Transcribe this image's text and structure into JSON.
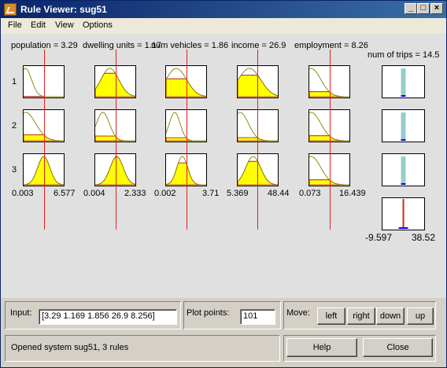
{
  "window": {
    "title": "Rule Viewer: sug51",
    "controls": {
      "minimize": "_",
      "maximize": "□",
      "close": "×"
    }
  },
  "menu": [
    "File",
    "Edit",
    "View",
    "Options"
  ],
  "inputs": [
    {
      "label": "population = 3.29",
      "range_min": "0.003",
      "range_max": "6.577",
      "value": 3.29,
      "min": 0.003,
      "max": 6.577,
      "mfs": [
        {
          "mean": 0.3,
          "sigma": 1.0
        },
        {
          "mean": 0.3,
          "sigma": 1.7
        },
        {
          "mean": 3.3,
          "sigma": 1.0
        }
      ]
    },
    {
      "label": "dwelling units = 1.17",
      "range_min": "0.004",
      "range_max": "2.333",
      "value": 1.169,
      "min": 0.004,
      "max": 2.333,
      "mfs": [
        {
          "mean": 0.85,
          "sigma": 0.52
        },
        {
          "mean": 0.45,
          "sigma": 0.38
        },
        {
          "mean": 1.25,
          "sigma": 0.38
        }
      ]
    },
    {
      "label": "num vehicles = 1.86",
      "range_min": "0.002",
      "range_max": "3.71",
      "value": 1.856,
      "min": 0.002,
      "max": 3.71,
      "mfs": [
        {
          "mean": 0.95,
          "sigma": 0.95
        },
        {
          "mean": 0.8,
          "sigma": 0.5
        },
        {
          "mean": 1.5,
          "sigma": 0.5
        }
      ]
    },
    {
      "label": "income = 26.9",
      "range_min": "5.369",
      "range_max": "48.44",
      "value": 26.9,
      "min": 5.369,
      "max": 48.44,
      "mfs": [
        {
          "mean": 18,
          "sigma": 12
        },
        {
          "mean": 8,
          "sigma": 9
        },
        {
          "mean": 22,
          "sigma": 8
        }
      ]
    },
    {
      "label": "employment = 8.26",
      "range_min": "0.073",
      "range_max": "16.439",
      "value": 8.256,
      "min": 0.073,
      "max": 16.439,
      "mfs": [
        {
          "mean": 0.8,
          "sigma": 4.0
        },
        {
          "mean": 0.8,
          "sigma": 4.0
        },
        {
          "mean": 0.8,
          "sigma": 4.0
        }
      ]
    }
  ],
  "output": {
    "label": "num of trips = 14.5",
    "range_min": "-9.597",
    "range_max": "38.52",
    "value": 14.5,
    "min": -9.597,
    "max": 38.52,
    "rule_bar_heights": [
      0.95,
      0.95,
      0.95
    ],
    "rule_bar_color": "#99cccc"
  },
  "rules": [
    "1",
    "2",
    "3"
  ],
  "colors": {
    "fill": "#ffff00",
    "fill_outline": "#a00000",
    "curve": "#808000",
    "indicator": "#e02020",
    "output_marker": "#0000ff"
  },
  "controls": {
    "input_label": "Input:",
    "input_value": "[3.29 1.169 1.856 26.9 8.256]",
    "plot_points_label": "Plot points:",
    "plot_points_value": "101",
    "move_label": "Move:",
    "move_buttons": [
      "left",
      "right",
      "down",
      "up"
    ],
    "status": "Opened system sug51, 3 rules",
    "help_label": "Help",
    "close_label": "Close"
  }
}
